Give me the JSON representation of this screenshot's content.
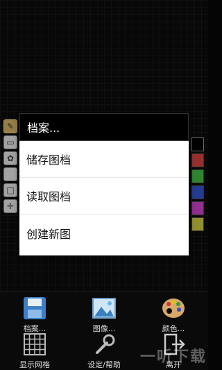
{
  "dialog": {
    "title": "档案...",
    "items": [
      {
        "label": "储存图档"
      },
      {
        "label": "读取图档"
      },
      {
        "label": "创建新图"
      }
    ]
  },
  "toolbar": {
    "buttons": [
      {
        "label": "档案...",
        "icon": "floppy-disk-icon"
      },
      {
        "label": "图像...",
        "icon": "image-icon"
      },
      {
        "label": "颜色...",
        "icon": "palette-icon"
      },
      {
        "label": "显示网格",
        "icon": "grid-icon"
      },
      {
        "label": "设定/帮助",
        "icon": "wrench-icon"
      },
      {
        "label": "离开",
        "icon": "exit-icon"
      }
    ]
  },
  "tools": [
    {
      "icon": "pencil-icon",
      "selected": true
    },
    {
      "icon": "eraser-icon",
      "selected": false
    },
    {
      "icon": "brush-icon",
      "selected": false
    },
    {
      "icon": "blank-tool-icon",
      "selected": false
    },
    {
      "icon": "square-tool-icon",
      "selected": false
    },
    {
      "icon": "move-icon",
      "selected": false
    }
  ],
  "palette": {
    "colors": [
      "#000000",
      "#c84040",
      "#40b040",
      "#3050c0",
      "#c040c0",
      "#c0c040"
    ]
  },
  "watermark": "一听下载"
}
